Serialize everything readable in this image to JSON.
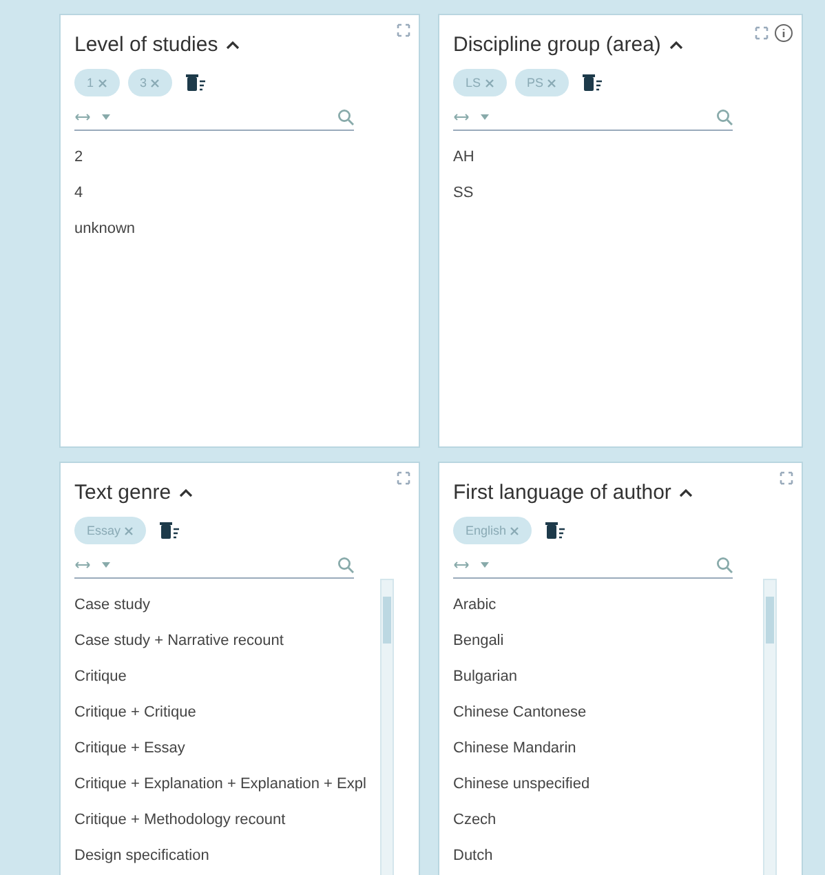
{
  "panels": [
    {
      "title": "Level of studies",
      "info_button": false,
      "scrollable": false,
      "chips": [
        {
          "label": "1"
        },
        {
          "label": "3"
        }
      ],
      "items": [
        "2",
        "4",
        "unknown"
      ]
    },
    {
      "title": "Discipline group (area)",
      "info_button": true,
      "scrollable": false,
      "chips": [
        {
          "label": "LS"
        },
        {
          "label": "PS"
        }
      ],
      "items": [
        "AH",
        "SS"
      ]
    },
    {
      "title": "Text genre",
      "info_button": false,
      "scrollable": true,
      "chips": [
        {
          "label": "Essay"
        }
      ],
      "items": [
        "Case study",
        "Case study + Narrative recount",
        "Critique",
        "Critique + Critique",
        "Critique + Essay",
        "Critique + Explanation + Explanation + Expl",
        "Critique + Methodology recount",
        "Design specification"
      ]
    },
    {
      "title": "First language of author",
      "info_button": false,
      "scrollable": true,
      "chips": [
        {
          "label": "English"
        }
      ],
      "items": [
        "Arabic",
        "Bengali",
        "Bulgarian",
        "Chinese Cantonese",
        "Chinese Mandarin",
        "Chinese unspecified",
        "Czech",
        "Dutch"
      ]
    }
  ]
}
